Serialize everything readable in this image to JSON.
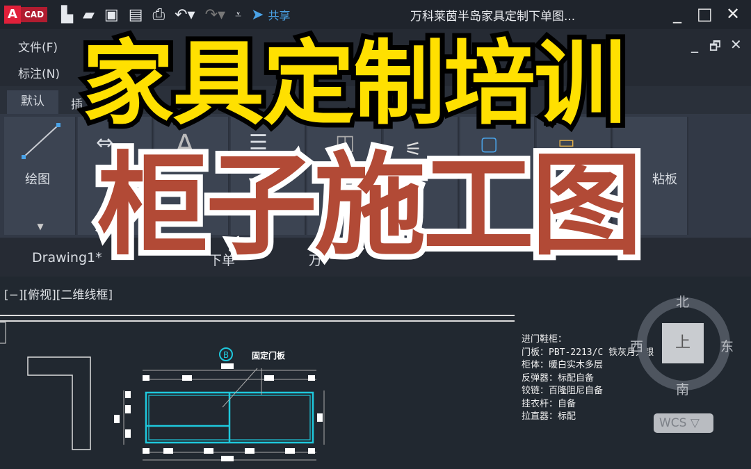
{
  "app": {
    "logo_letter": "A",
    "logo_text": "CAD",
    "share": "共享",
    "doc_title": "万科莱茵半岛家具定制下单图...",
    "minimize": "_",
    "maximize": "□",
    "close": "✕",
    "doc_restore": "🗗",
    "doc_close": "✕",
    "doc_minimize": "_"
  },
  "quick_access": [
    "new-icon",
    "open-icon",
    "save-icon",
    "save-as-icon",
    "print-icon",
    "undo-icon",
    "redo-icon",
    "customize-icon",
    "share-icon"
  ],
  "menu": {
    "row1": [
      "文件(F)"
    ],
    "row2": [
      "标注(N)"
    ]
  },
  "ribbon": {
    "active_tab": "默认",
    "tab2": "插",
    "panels": {
      "draw": "绘图",
      "clipboard": "粘板"
    }
  },
  "file_tabs": {
    "tab1": "Drawing1*",
    "tab2": "下单",
    "tab3": "万"
  },
  "viewport": {
    "label": "[−][俯视][二维线框]"
  },
  "overlay": {
    "line1": "家具定制培训",
    "line2": "柜子施工图"
  },
  "drawing": {
    "callout": "B",
    "leader_label": "固定门板"
  },
  "notes": [
    "进门鞋柜：",
    "门板：PBT-2213/C 铁灰月光银",
    "柜体：暖白实木多层",
    "反弹器：标配自备",
    "铰链：百隆阻尼自备",
    "挂衣杆：自备",
    "拉直器：标配"
  ],
  "viewcube": {
    "face": "上",
    "north": "北",
    "south": "南",
    "east": "东",
    "west": "西",
    "wcs": "WCS ▽"
  },
  "colors": {
    "overlay_line1": "#ffe000",
    "overlay_line2": "#b24a36",
    "cabinet_outline": "#1ec8dc",
    "logo": "#e0203a"
  }
}
